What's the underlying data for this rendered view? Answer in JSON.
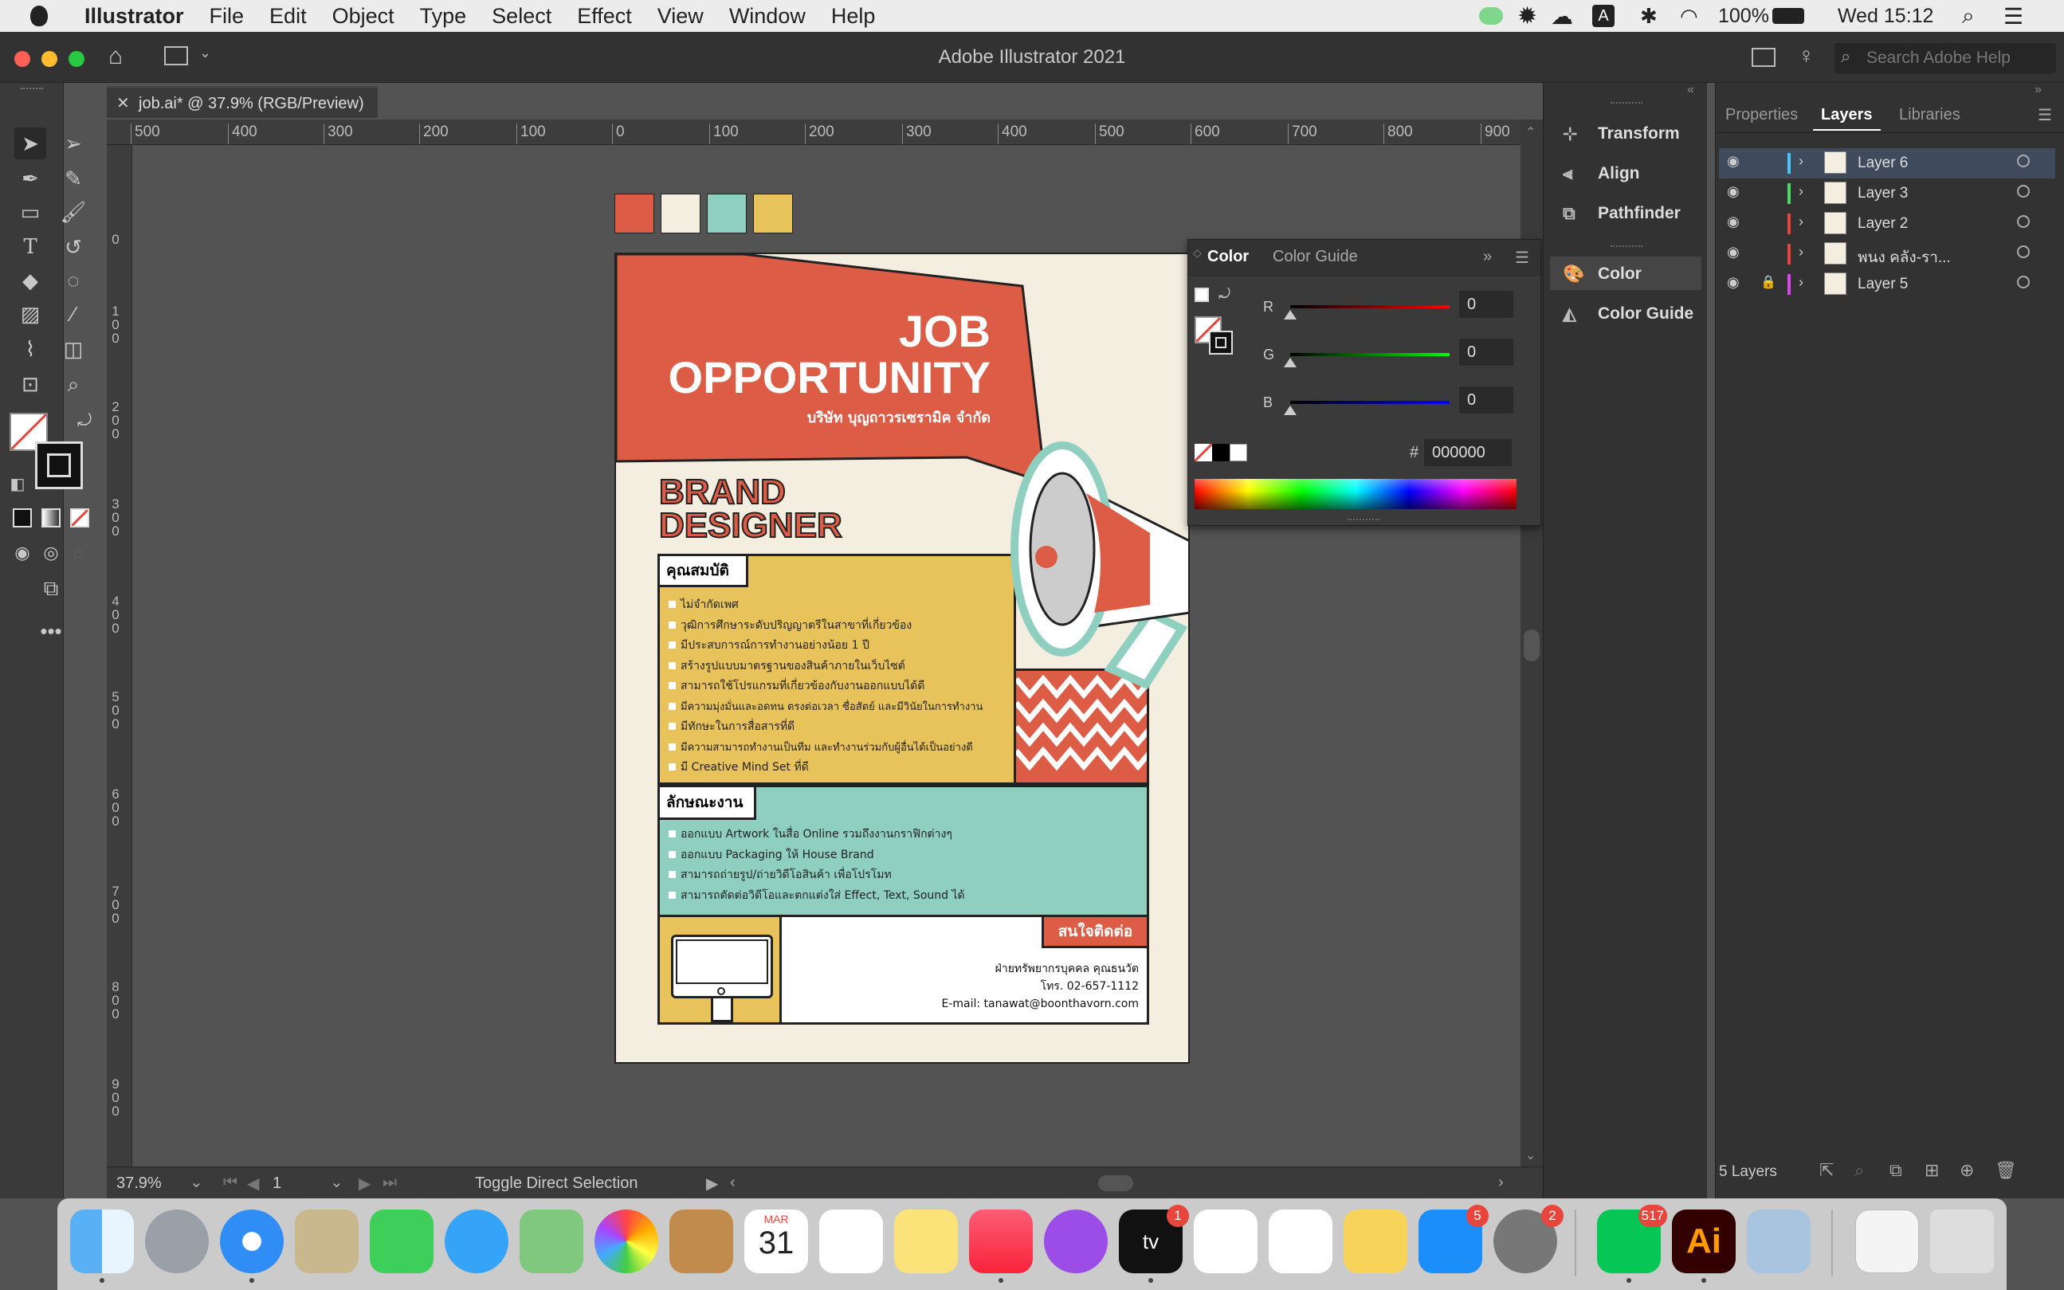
{
  "menubar": {
    "app_name": "Illustrator",
    "items": [
      "File",
      "Edit",
      "Object",
      "Type",
      "Select",
      "Effect",
      "View",
      "Window",
      "Help"
    ],
    "battery": "100%",
    "clock": "Wed 15:12"
  },
  "window": {
    "title": "Adobe Illustrator 2021",
    "search_placeholder": "Search Adobe Help"
  },
  "document": {
    "tab_label": "job.ai* @ 37.9% (RGB/Preview)",
    "zoom": "37.9%",
    "artboard_number": "1",
    "status_text": "Toggle Direct Selection"
  },
  "rulers": {
    "top": [
      "500",
      "400",
      "300",
      "200",
      "100",
      "0",
      "100",
      "200",
      "300",
      "400",
      "500",
      "600",
      "700",
      "800",
      "900"
    ],
    "left": [
      "0",
      "100",
      "200",
      "300",
      "400",
      "500",
      "600",
      "700",
      "800",
      "900"
    ]
  },
  "swatch_colors": [
    "#dc5c45",
    "#f4eee0",
    "#8fcfbf",
    "#e8c25a"
  ],
  "poster": {
    "headline_1": "JOB",
    "headline_2": "OPPORTUNITY",
    "company": "บริษัท บุญถาวรเซรามิค จำกัด",
    "role_1": "BRAND",
    "role_2": "DESIGNER",
    "qualifications_title": "คุณสมบัติ",
    "qualifications": [
      "ไม่จำกัดเพศ",
      "วุฒิการศึกษาระดับปริญญาตรีในสาขาที่เกี่ยวข้อง",
      "มีประสบการณ์การทำงานอย่างน้อย 1 ปี",
      "สร้างรูปแบบมาตรฐานของสินค้าภายในเว็บไซต์",
      "สามารถใช้โปรแกรมที่เกี่ยวข้องกับงานออกแบบได้ดี",
      "มีความมุ่งมั่นและอดทน ตรงต่อเวลา ซื่อสัตย์ และมีวินัยในการทำงาน",
      "มีทักษะในการสื่อสารที่ดี",
      "มีความสามารถทำงานเป็นทีม และทำงานร่วมกับผู้อื่นได้เป็นอย่างดี",
      "มี Creative Mind Set ที่ดี"
    ],
    "duties_title": "ลักษณะงาน",
    "duties": [
      "ออกแบบ Artwork ในสื่อ Online รวมถึงงานกราฟิกต่างๆ",
      "ออกแบบ Packaging ให้ House Brand",
      "สามารถถ่ายรูป/ถ่ายวิดีโอสินค้า เพื่อโปรโมท",
      "สามารถตัดต่อวิดีโอและตกแต่งใส่ Effect, Text, Sound ได้"
    ],
    "contact_title": "สนใจติดต่อ",
    "contact_line1": "ฝ่ายทรัพยากรบุคคล คุณธนวัต",
    "contact_line2": "โทร. 02-657-1112",
    "contact_line3": "E-mail: tanawat@boonthavorn.com",
    "colors": {
      "red": "#dc5c45",
      "cream": "#f4eee0",
      "teal": "#8fcfbf",
      "yellow": "#e8c25a"
    }
  },
  "color_panel": {
    "tabs": [
      "Color",
      "Color Guide"
    ],
    "r_label": "R",
    "g_label": "G",
    "b_label": "B",
    "r": "0",
    "g": "0",
    "b": "0",
    "hex": "000000"
  },
  "dock_panels": {
    "group1": [
      "Transform",
      "Align",
      "Pathfinder"
    ],
    "group2": [
      "Color",
      "Color Guide"
    ]
  },
  "right_panel": {
    "tabs": [
      "Properties",
      "Layers",
      "Libraries"
    ],
    "active_tab": "Layers",
    "layers": [
      {
        "name": "Layer 6",
        "color": "#4fc3f7",
        "locked": false
      },
      {
        "name": "Layer 3",
        "color": "#4cd964",
        "locked": false
      },
      {
        "name": "Layer 2",
        "color": "#e8453c",
        "locked": false
      },
      {
        "name": "พนง คลัง-รา...",
        "color": "#e8453c",
        "locked": false
      },
      {
        "name": "Layer 5",
        "color": "#d946ef",
        "locked": true
      }
    ],
    "layer_count": "5 Layers"
  },
  "dock": {
    "badges": {
      "appletv": "1",
      "appstore": "5",
      "sysprefs": "2",
      "line": "517"
    },
    "calendar_month": "MAR",
    "calendar_day": "31",
    "illustrator_label": "Ai"
  }
}
